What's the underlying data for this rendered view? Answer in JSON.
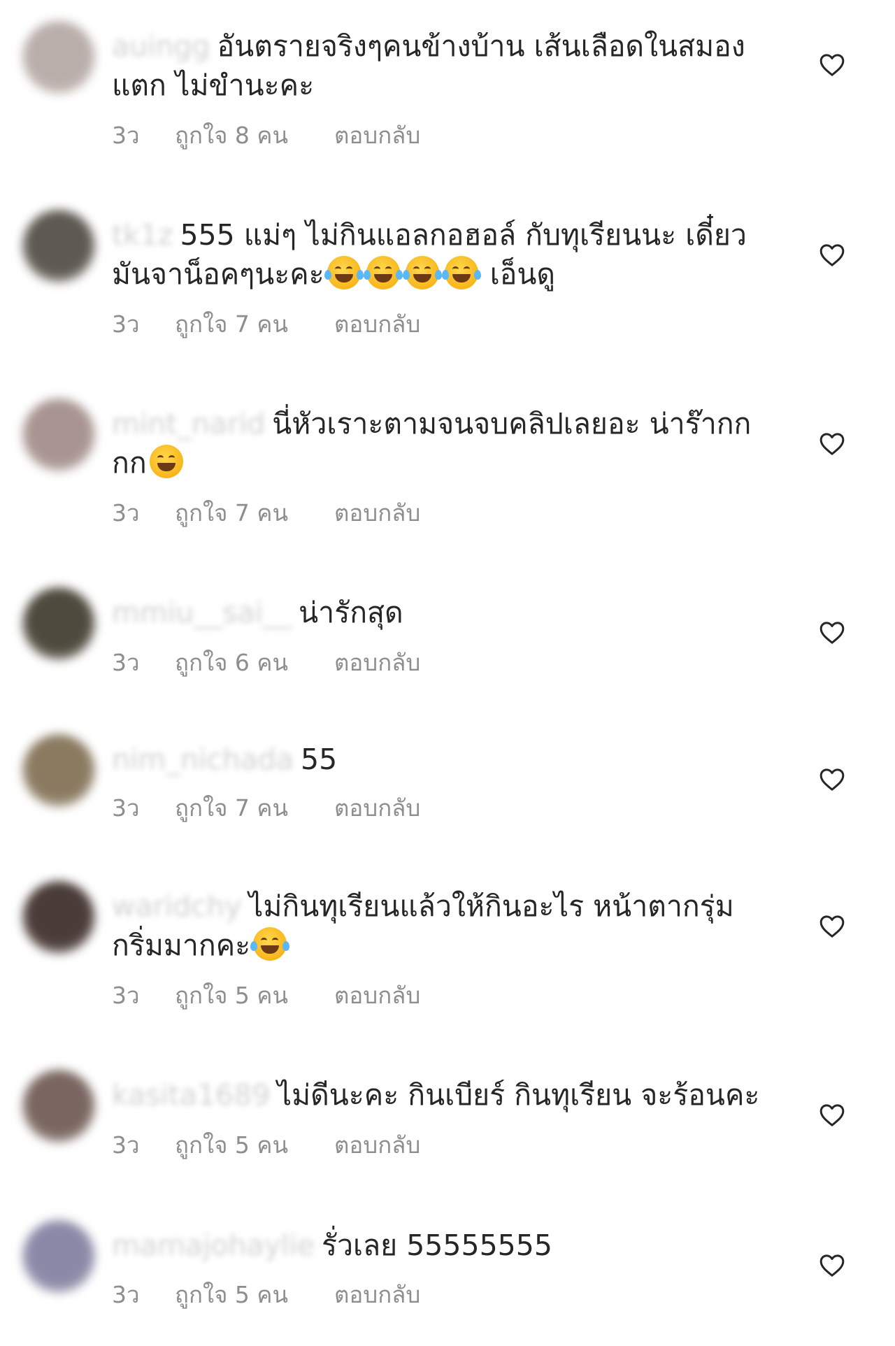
{
  "comments": [
    {
      "username": "auingg",
      "text": "อันตรายจริงๆคนข้างบ้าน เส้นเลือดในสมองแตก ไม่ขำนะคะ",
      "emojis": [],
      "time": "3ว",
      "likes": "ถูกใจ 8 คน",
      "reply": "ตอบกลับ",
      "avatar_color": "#b9aeaa"
    },
    {
      "username": "tk1z",
      "text": "555 แม่ๆ ไม่กินแอลกอฮอล์ กับทุเรียนนะ  เดี๋ยวมันจาน็อคๆนะคะ",
      "emojis": [
        "face-with-tears-of-joy",
        "face-with-tears-of-joy",
        "face-with-tears-of-joy",
        "face-with-tears-of-joy"
      ],
      "text_after": " เอ็นดู",
      "time": "3ว",
      "likes": "ถูกใจ 7 คน",
      "reply": "ตอบกลับ",
      "avatar_color": "#5e5a52"
    },
    {
      "username": "mint_narid",
      "text": "นี่หัวเราะตามจนจบคลิปเลยอะ น่าร๊ากกกก",
      "emojis": [
        "grinning-squinting-face"
      ],
      "time": "3ว",
      "likes": "ถูกใจ 7 คน",
      "reply": "ตอบกลับ",
      "avatar_color": "#a89490"
    },
    {
      "username": "mmiu__sai__",
      "text": "น่ารักสุด",
      "emojis": [],
      "time": "3ว",
      "likes": "ถูกใจ 6 คน",
      "reply": "ตอบกลับ",
      "avatar_color": "#4f4a3e"
    },
    {
      "username": "nim_nichada",
      "text": "55",
      "emojis": [],
      "time": "3ว",
      "likes": "ถูกใจ 7 คน",
      "reply": "ตอบกลับ",
      "avatar_color": "#8a7a60"
    },
    {
      "username": "waridchy",
      "text": "ไม่กินทุเรียนแล้วให้กินอะไร หน้าตากรุ่มกริ่มมากคะ",
      "emojis": [
        "face-with-tears-of-joy"
      ],
      "time": "3ว",
      "likes": "ถูกใจ 5 คน",
      "reply": "ตอบกลับ",
      "avatar_color": "#4a3c38"
    },
    {
      "username": "kasita1689",
      "text": "ไม่ดีนะคะ กินเบียร์ กินทุเรียน จะร้อนคะ",
      "emojis": [],
      "time": "3ว",
      "likes": "ถูกใจ 5 คน",
      "reply": "ตอบกลับ",
      "avatar_color": "#7a6660"
    },
    {
      "username": "mamajohaylie",
      "text": "รั่วเลย 55555555",
      "emojis": [],
      "time": "3ว",
      "likes": "ถูกใจ 5 คน",
      "reply": "ตอบกลับ",
      "avatar_color": "#8a8aa8"
    }
  ],
  "icons": {
    "like": "heart-outline-icon"
  },
  "colors": {
    "meta_text": "#8e8e8e",
    "body_text": "#262626",
    "heart_stroke": "#262626"
  }
}
